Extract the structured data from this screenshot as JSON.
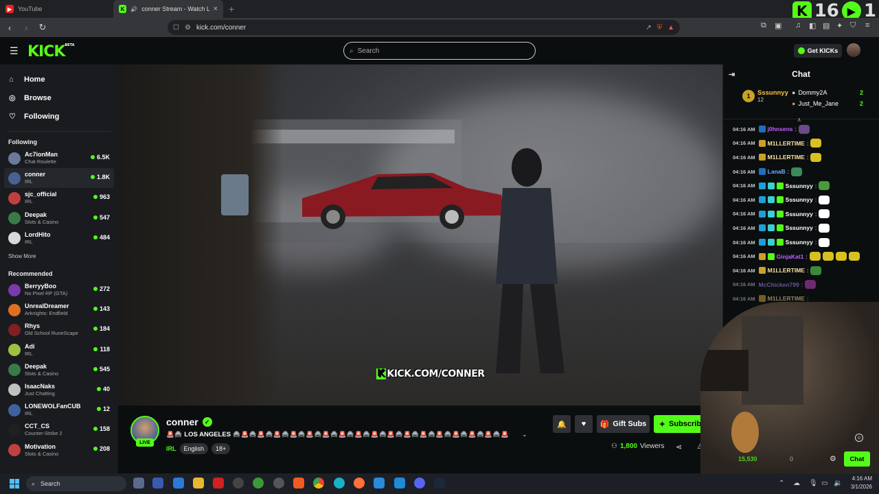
{
  "browser": {
    "tabs": [
      {
        "title": "YouTube",
        "active": false
      },
      {
        "title": "conner Stream - Watch Live o",
        "active": true
      }
    ],
    "url": "kick.com/conner",
    "overlay_counter": {
      "kick_count": "16",
      "play_count": "1"
    }
  },
  "header": {
    "logo": "KICK",
    "logo_beta": "BETA",
    "search_placeholder": "Search",
    "get_kicks": "Get KICKs"
  },
  "sidebar": {
    "nav": [
      {
        "label": "Home",
        "icon": "home-icon"
      },
      {
        "label": "Browse",
        "icon": "compass-icon"
      },
      {
        "label": "Following",
        "icon": "heart-icon"
      }
    ],
    "following_title": "Following",
    "following": [
      {
        "name": "Ac7ionMan",
        "category": "Chat Roulette",
        "viewers": "6.5K",
        "color": "#6a7a9a"
      },
      {
        "name": "conner",
        "category": "IRL",
        "viewers": "1.8K",
        "color": "#4a6090",
        "active": true
      },
      {
        "name": "sjc_official",
        "category": "IRL",
        "viewers": "963",
        "color": "#c04040"
      },
      {
        "name": "Deepak",
        "category": "Slots & Casino",
        "viewers": "547",
        "color": "#3a7a4a"
      },
      {
        "name": "LordHito",
        "category": "IRL",
        "viewers": "484",
        "color": "#d8d8d8"
      }
    ],
    "show_more": "Show More",
    "recommended_title": "Recommended",
    "recommended": [
      {
        "name": "BerryyBoo",
        "category": "No Pixel RP (GTA)",
        "viewers": "272",
        "color": "#7a3aaa"
      },
      {
        "name": "UnrealDreamer",
        "category": "Arknights: Endfield",
        "viewers": "143",
        "color": "#e07020"
      },
      {
        "name": "Rhys",
        "category": "Old School RuneScape",
        "viewers": "184",
        "color": "#802020"
      },
      {
        "name": "Adi",
        "category": "IRL",
        "viewers": "118",
        "color": "#a0c040"
      },
      {
        "name": "Deepak",
        "category": "Slots & Casino",
        "viewers": "545",
        "color": "#3a7a4a"
      },
      {
        "name": "IsaacNaks",
        "category": "Just Chatting",
        "viewers": "40",
        "color": "#c0c0c0"
      },
      {
        "name": "LONEWOLFanCUB",
        "category": "IRL",
        "viewers": "12",
        "color": "#4060a0"
      },
      {
        "name": "CCT_CS",
        "category": "Counter-Strike 2",
        "viewers": "158",
        "color": "#202020"
      },
      {
        "name": "Motivation",
        "category": "Slots & Casino",
        "viewers": "208",
        "color": "#c04040"
      }
    ]
  },
  "video": {
    "watermark_k": "K",
    "watermark_text": "KICK.COM/CONNER"
  },
  "stream_info": {
    "live_badge": "LIVE",
    "streamer": "conner",
    "title": "🚨🚔 LOS ANGELES 🚔🚨🚔🚨🚔🚨🚔🚨🚔🚨🚔🚨🚔🚨🚔🚨🚔🚨🚔🚨🚔🚨🚔🚨🚔🚨🚔🚨🚔🚨🚔🚨🚔🚨🚔...",
    "category": "IRL",
    "tags": [
      "English",
      "18+"
    ],
    "gift_subs": "Gift Subs",
    "subscribe": "Subscribe",
    "viewers_count": "1,800",
    "viewers_label": "Viewers"
  },
  "chat": {
    "title": "Chat",
    "leader_top": {
      "rank": "1",
      "name": "Sssunnyy",
      "count": "12"
    },
    "leaders": [
      {
        "name": "Dommy2A",
        "count": "2"
      },
      {
        "name": "Just_Me_Jane",
        "count": "2"
      }
    ],
    "messages": [
      {
        "time": "04:16 AM",
        "user": "j0hnsens",
        "color": "#c060ff",
        "badges": [
          "#1f6fbf"
        ],
        "emotes": [
          "#6a4a8a"
        ]
      },
      {
        "time": "04:16 AM",
        "user": "M1LLERTIME",
        "color": "#f6e0a0",
        "badges": [
          "#c9a227"
        ],
        "emotes": [
          "#d8c020"
        ]
      },
      {
        "time": "04:16 AM",
        "user": "M1LLERTIME",
        "color": "#f6e0a0",
        "badges": [
          "#c9a227"
        ],
        "emotes": [
          "#d8c020"
        ]
      },
      {
        "time": "04:16 AM",
        "user": "LanaB",
        "color": "#6ab0ff",
        "badges": [
          "#1f6fbf"
        ],
        "emotes": [
          "#3a8a5a"
        ]
      },
      {
        "time": "04:16 AM",
        "user": "Sssunnyy",
        "color": "#ffffff",
        "badges": [
          "#1f9fd8",
          "#3ad0d0",
          "#53fc18"
        ],
        "emotes": [
          "#4a9a3a"
        ]
      },
      {
        "time": "04:16 AM",
        "user": "Sssunnyy",
        "color": "#ffffff",
        "badges": [
          "#1f9fd8",
          "#3ad0d0",
          "#53fc18"
        ],
        "emotes": [
          "#ffffff"
        ]
      },
      {
        "time": "04:16 AM",
        "user": "Sssunnyy",
        "color": "#ffffff",
        "badges": [
          "#1f9fd8",
          "#3ad0d0",
          "#53fc18"
        ],
        "emotes": [
          "#ffffff"
        ]
      },
      {
        "time": "04:16 AM",
        "user": "Sssunnyy",
        "color": "#ffffff",
        "badges": [
          "#1f9fd8",
          "#3ad0d0",
          "#53fc18"
        ],
        "emotes": [
          "#ffffff"
        ]
      },
      {
        "time": "04:16 AM",
        "user": "Sssunnyy",
        "color": "#ffffff",
        "badges": [
          "#1f9fd8",
          "#3ad0d0",
          "#53fc18"
        ],
        "emotes": [
          "#ffffff"
        ]
      },
      {
        "time": "04:16 AM",
        "user": "GinjaKat1",
        "color": "#c060ff",
        "badges": [
          "#c9a227",
          "#53fc18"
        ],
        "emotes": [
          "#d8c020",
          "#d8c020",
          "#d8c020",
          "#d8c020"
        ]
      },
      {
        "time": "04:16 AM",
        "user": "M1LLERTIME",
        "color": "#f6e0a0",
        "badges": [
          "#c9a227"
        ],
        "emotes": [
          "#3a8a3a"
        ]
      },
      {
        "time": "04:16 AM",
        "user": "McChicken799",
        "color": "#b090ff",
        "badges": [],
        "emotes": [
          "#c040c0"
        ]
      },
      {
        "time": "04:16 AM",
        "user": "M1LLERTIME",
        "color": "#f6e0a0",
        "badges": [
          "#c9a227"
        ],
        "emotes": []
      }
    ],
    "kicks_count": "15,530",
    "zero_count": "0",
    "chat_button": "Chat"
  },
  "taskbar": {
    "search": "Search",
    "time": "4:16 AM",
    "date": "3/1/2026"
  }
}
